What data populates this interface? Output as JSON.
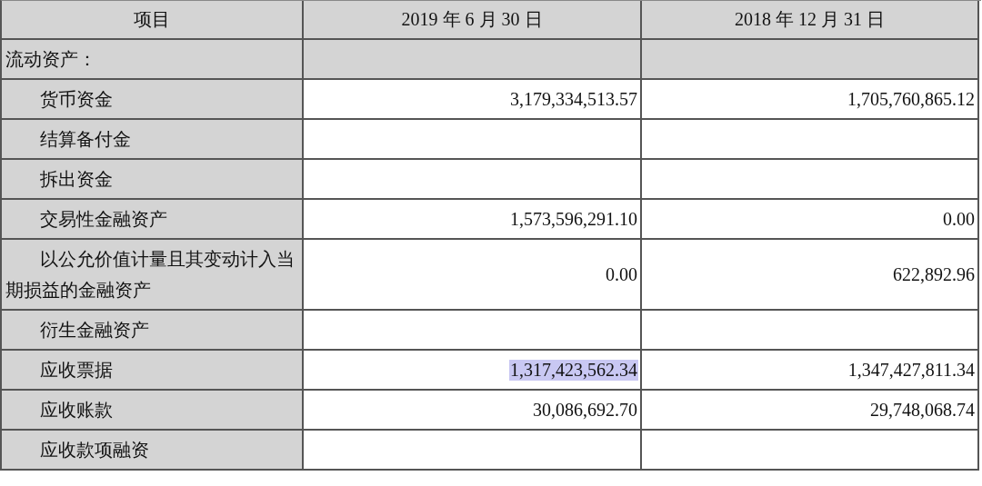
{
  "table": {
    "columns": [
      "项目",
      "2019 年 6 月 30 日",
      "2018 年 12 月 31 日"
    ],
    "rows": [
      {
        "kind": "section",
        "label": "流动资产：",
        "values": []
      },
      {
        "kind": "item",
        "label": "货币资金",
        "values": [
          {
            "text": "3,179,334,513.57",
            "highlighted": false
          },
          {
            "text": "1,705,760,865.12",
            "highlighted": false
          }
        ]
      },
      {
        "kind": "item",
        "label": "结算备付金",
        "values": []
      },
      {
        "kind": "item",
        "label": "拆出资金",
        "values": []
      },
      {
        "kind": "item",
        "label": "交易性金融资产",
        "values": [
          {
            "text": "1,573,596,291.10",
            "highlighted": false
          },
          {
            "text": "0.00",
            "highlighted": false
          }
        ]
      },
      {
        "kind": "item",
        "label": "以公允价值计量且其变动计入当期损益的金融资产",
        "values": [
          {
            "text": "0.00",
            "highlighted": false
          },
          {
            "text": "622,892.96",
            "highlighted": false
          }
        ]
      },
      {
        "kind": "item",
        "label": "衍生金融资产",
        "values": []
      },
      {
        "kind": "item",
        "label": "应收票据",
        "values": [
          {
            "text": "1,317,423,562.34",
            "highlighted": true
          },
          {
            "text": "1,347,427,811.34",
            "highlighted": false
          }
        ]
      },
      {
        "kind": "item",
        "label": "应收账款",
        "values": [
          {
            "text": "30,086,692.70",
            "highlighted": false
          },
          {
            "text": "29,748,068.74",
            "highlighted": false
          }
        ]
      },
      {
        "kind": "item",
        "label": "应收款项融资",
        "values": []
      }
    ]
  }
}
